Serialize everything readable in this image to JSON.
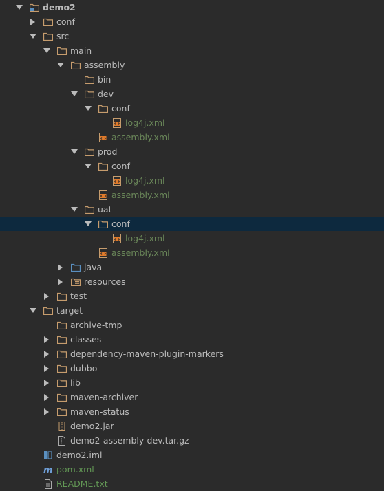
{
  "project_view": {
    "colors": {
      "background": "#2b2b2b",
      "selection": "#0d293e",
      "text": "#bbbbbb",
      "xml_text": "#6a8759",
      "folder": "#c69c6d",
      "source_folder": "#5a8fbf"
    },
    "nodes": [
      {
        "label": "demo2",
        "depth": 0,
        "arrow": "down",
        "icon": "module-folder-icon",
        "style": "bold"
      },
      {
        "label": "conf",
        "depth": 1,
        "arrow": "right",
        "icon": "folder-icon",
        "style": "plain"
      },
      {
        "label": "src",
        "depth": 1,
        "arrow": "down",
        "icon": "folder-icon",
        "style": "plain"
      },
      {
        "label": "main",
        "depth": 2,
        "arrow": "down",
        "icon": "folder-icon",
        "style": "plain"
      },
      {
        "label": "assembly",
        "depth": 3,
        "arrow": "down",
        "icon": "folder-icon",
        "style": "plain"
      },
      {
        "label": "bin",
        "depth": 4,
        "arrow": "none",
        "icon": "folder-icon",
        "style": "plain"
      },
      {
        "label": "dev",
        "depth": 4,
        "arrow": "down",
        "icon": "folder-icon",
        "style": "plain"
      },
      {
        "label": "conf",
        "depth": 5,
        "arrow": "down",
        "icon": "folder-icon",
        "style": "plain"
      },
      {
        "label": "log4j.xml",
        "depth": 6,
        "arrow": "none",
        "icon": "xml-file-icon",
        "style": "green"
      },
      {
        "label": "assembly.xml",
        "depth": 5,
        "arrow": "none",
        "icon": "xml-file-icon",
        "style": "green"
      },
      {
        "label": "prod",
        "depth": 4,
        "arrow": "down",
        "icon": "folder-icon",
        "style": "plain"
      },
      {
        "label": "conf",
        "depth": 5,
        "arrow": "down",
        "icon": "folder-icon",
        "style": "plain"
      },
      {
        "label": "log4j.xml",
        "depth": 6,
        "arrow": "none",
        "icon": "xml-file-icon",
        "style": "green"
      },
      {
        "label": "assembly.xml",
        "depth": 5,
        "arrow": "none",
        "icon": "xml-file-icon",
        "style": "green"
      },
      {
        "label": "uat",
        "depth": 4,
        "arrow": "down",
        "icon": "folder-icon",
        "style": "plain"
      },
      {
        "label": "conf",
        "depth": 5,
        "arrow": "down",
        "icon": "folder-icon",
        "style": "plain",
        "selected": true
      },
      {
        "label": "log4j.xml",
        "depth": 6,
        "arrow": "none",
        "icon": "xml-file-icon",
        "style": "green"
      },
      {
        "label": "assembly.xml",
        "depth": 5,
        "arrow": "none",
        "icon": "xml-file-icon",
        "style": "green"
      },
      {
        "label": "java",
        "depth": 3,
        "arrow": "right",
        "icon": "source-folder-icon",
        "style": "plain"
      },
      {
        "label": "resources",
        "depth": 3,
        "arrow": "right",
        "icon": "resources-folder-icon",
        "style": "plain"
      },
      {
        "label": "test",
        "depth": 2,
        "arrow": "right",
        "icon": "folder-icon",
        "style": "plain"
      },
      {
        "label": "target",
        "depth": 1,
        "arrow": "down",
        "icon": "folder-icon",
        "style": "plain"
      },
      {
        "label": "archive-tmp",
        "depth": 2,
        "arrow": "none",
        "icon": "folder-icon",
        "style": "plain"
      },
      {
        "label": "classes",
        "depth": 2,
        "arrow": "right",
        "icon": "folder-icon",
        "style": "plain"
      },
      {
        "label": "dependency-maven-plugin-markers",
        "depth": 2,
        "arrow": "right",
        "icon": "folder-icon",
        "style": "plain"
      },
      {
        "label": "dubbo",
        "depth": 2,
        "arrow": "right",
        "icon": "folder-icon",
        "style": "plain"
      },
      {
        "label": "lib",
        "depth": 2,
        "arrow": "right",
        "icon": "folder-icon",
        "style": "plain"
      },
      {
        "label": "maven-archiver",
        "depth": 2,
        "arrow": "right",
        "icon": "folder-icon",
        "style": "plain"
      },
      {
        "label": "maven-status",
        "depth": 2,
        "arrow": "right",
        "icon": "folder-icon",
        "style": "plain"
      },
      {
        "label": "demo2.jar",
        "depth": 2,
        "arrow": "none",
        "icon": "jar-file-icon",
        "style": "plain"
      },
      {
        "label": "demo2-assembly-dev.tar.gz",
        "depth": 2,
        "arrow": "none",
        "icon": "archive-file-icon",
        "style": "plain"
      },
      {
        "label": "demo2.iml",
        "depth": 1,
        "arrow": "none",
        "icon": "iml-file-icon",
        "style": "plain"
      },
      {
        "label": "pom.xml",
        "depth": 1,
        "arrow": "none",
        "icon": "maven-file-icon",
        "style": "green2"
      },
      {
        "label": "README.txt",
        "depth": 1,
        "arrow": "none",
        "icon": "text-file-icon",
        "style": "green2"
      }
    ]
  }
}
